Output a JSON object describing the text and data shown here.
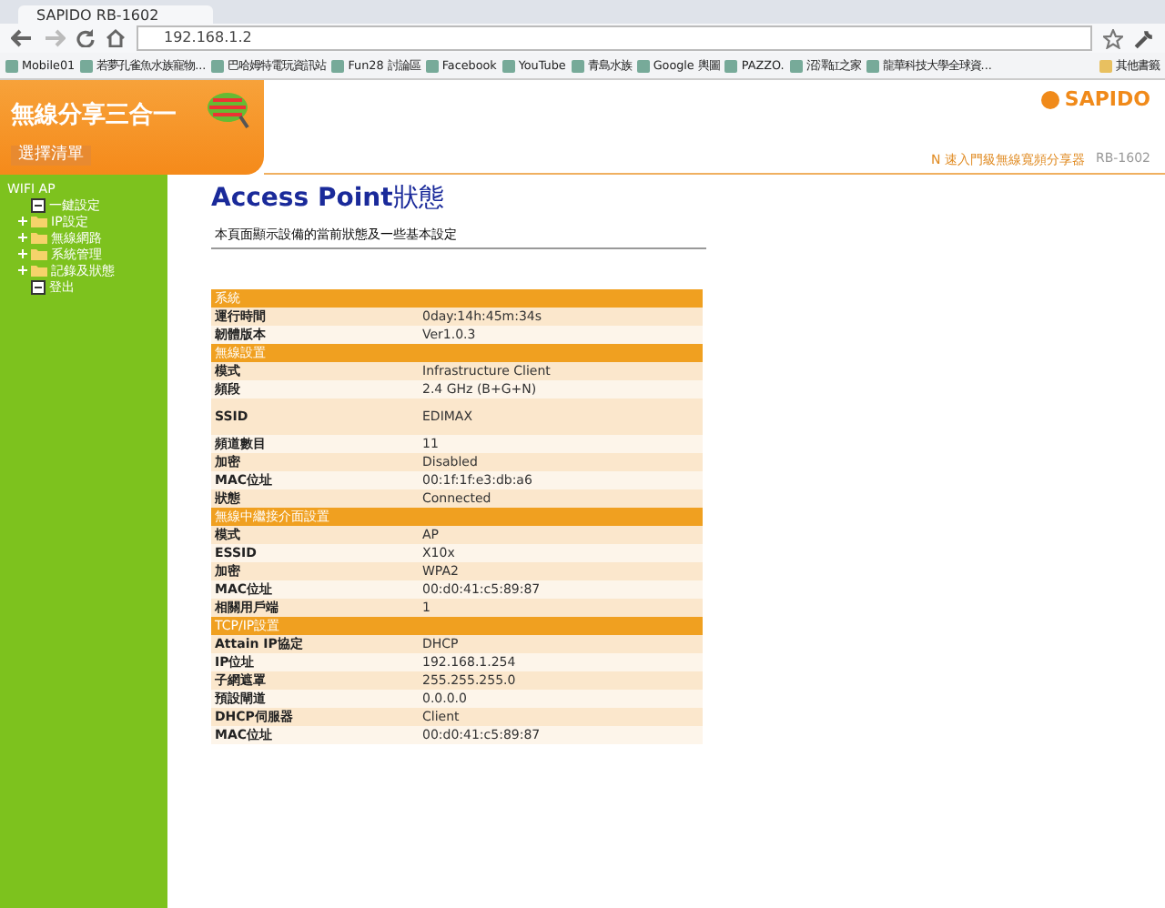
{
  "browser": {
    "tab_title": "SAPIDO RB-1602",
    "url": "192.168.1.2",
    "bookmarks": [
      "Mobile01",
      "若夢孔雀魚水族寵物...",
      "巴哈姆特電玩資訊站",
      "Fun28 討論區",
      "Facebook",
      "YouTube",
      "青島水族",
      "Google 輿圖",
      "PAZZO.",
      "沼澤缸之家",
      "龍華科技大學全球資..."
    ],
    "other_bookmarks": "其他書籤"
  },
  "header": {
    "product": "無線分享三合一",
    "menu_button": "選擇清單",
    "brand": "SAPIDO",
    "tagline": "N 速入門級無線寬頻分享器",
    "model": "RB-1602"
  },
  "sidebar": {
    "root": "WIFI AP",
    "items": [
      {
        "label": "一鍵設定",
        "kind": "page"
      },
      {
        "label": "IP設定",
        "kind": "folder",
        "expanded": false
      },
      {
        "label": "無線網路",
        "kind": "folder",
        "expanded": false
      },
      {
        "label": "系統管理",
        "kind": "folder",
        "expanded": false
      },
      {
        "label": "記錄及狀態",
        "kind": "folder",
        "expanded": false
      },
      {
        "label": "登出",
        "kind": "page"
      }
    ]
  },
  "title_latin": "Access Point",
  "title_cjk": "狀態",
  "description": "本頁面顯示設備的當前狀態及一些基本設定",
  "sections": [
    {
      "title": "系統",
      "rows": [
        {
          "label": "運行時間",
          "value": "0day:14h:45m:34s"
        },
        {
          "label": "韌體版本",
          "value": "Ver1.0.3"
        }
      ]
    },
    {
      "title": "無線設置",
      "rows": [
        {
          "label": "模式",
          "value": "Infrastructure Client"
        },
        {
          "label": "頻段",
          "value": "2.4 GHz (B+G+N)"
        },
        {
          "label": "SSID",
          "value": "EDIMAX",
          "tall": true
        },
        {
          "label": "頻道數目",
          "value": "11"
        },
        {
          "label": "加密",
          "value": "Disabled"
        },
        {
          "label": "MAC位址",
          "value": "00:1f:1f:e3:db:a6"
        },
        {
          "label": "狀態",
          "value": "Connected"
        }
      ]
    },
    {
      "title": "無線中繼接介面設置",
      "rows": [
        {
          "label": "模式",
          "value": "AP"
        },
        {
          "label": "ESSID",
          "value": "X10x"
        },
        {
          "label": "加密",
          "value": "WPA2"
        },
        {
          "label": "MAC位址",
          "value": "00:d0:41:c5:89:87"
        },
        {
          "label": "相關用戶端",
          "value": "1"
        }
      ]
    },
    {
      "title": "TCP/IP設置",
      "rows": [
        {
          "label": "Attain IP協定",
          "value": "DHCP"
        },
        {
          "label": "IP位址",
          "value": "192.168.1.254"
        },
        {
          "label": "子網遮罩",
          "value": "255.255.255.0"
        },
        {
          "label": "預設閘道",
          "value": "0.0.0.0"
        },
        {
          "label": "DHCP伺服器",
          "value": "Client"
        },
        {
          "label": "MAC位址",
          "value": "00:d0:41:c5:89:87"
        }
      ]
    }
  ]
}
